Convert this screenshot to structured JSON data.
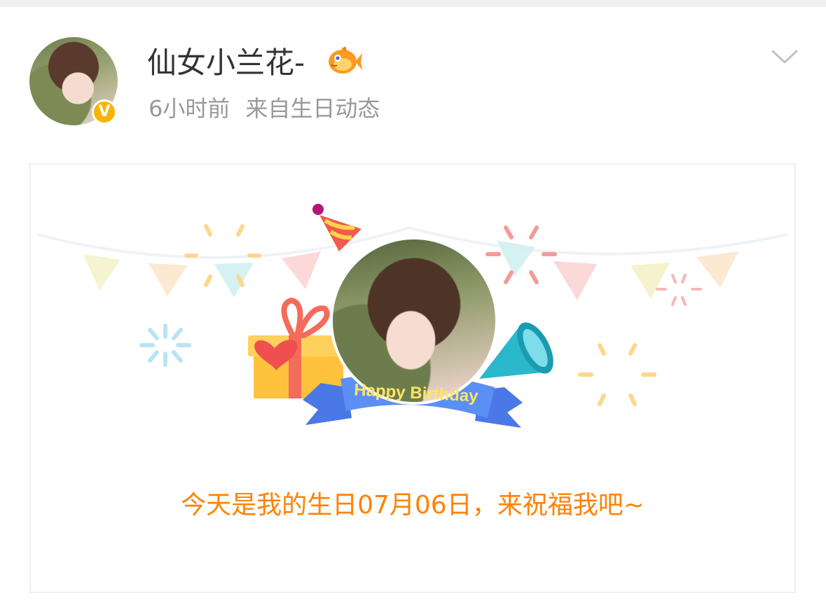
{
  "post": {
    "username": "仙女小兰花-",
    "verified_badge": "V",
    "time": "6小时前",
    "source": "来自生日动态",
    "icons": {
      "badge_icon": "fish-emoji-icon",
      "menu_icon": "chevron-down-icon",
      "verified_icon": "verified-v-icon"
    }
  },
  "card": {
    "ribbon_text": "Happy Birthday",
    "message": "今天是我的生日07月06日，来祝福我吧~"
  },
  "colors": {
    "accent_orange": "#ff8200",
    "verified_yellow": "#f8b500",
    "ribbon_blue": "#5b8ff5",
    "ribbon_text": "#ffe566"
  }
}
